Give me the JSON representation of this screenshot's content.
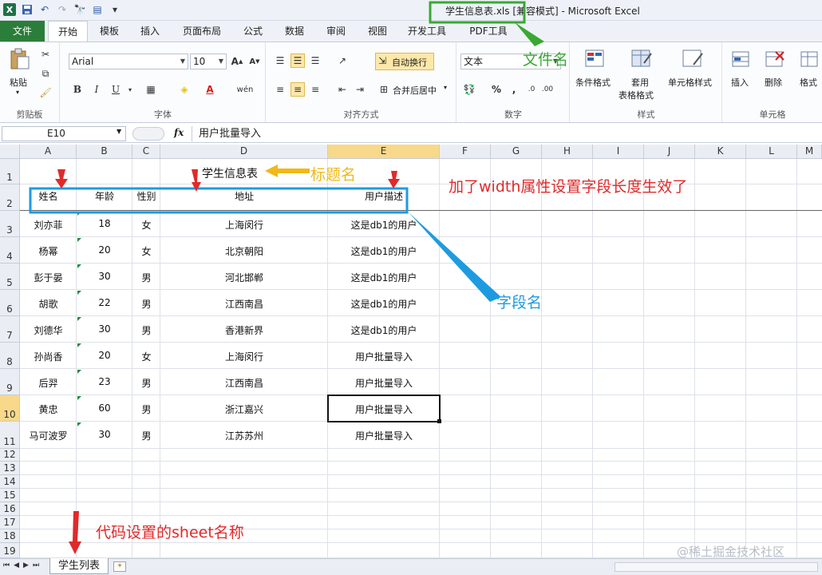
{
  "window": {
    "title": "学生信息表.xls  [兼容模式]  -  Microsoft Excel"
  },
  "tabs": [
    "文件",
    "开始",
    "模板",
    "插入",
    "页面布局",
    "公式",
    "数据",
    "审阅",
    "视图",
    "开发工具",
    "PDF工具"
  ],
  "ribbon": {
    "clipboard": {
      "paste": "粘贴",
      "label": "剪贴板"
    },
    "font": {
      "name": "Arial",
      "size": "10",
      "label": "字体",
      "bold": "B",
      "italic": "I",
      "underline": "U"
    },
    "alignment": {
      "wrap": "自动换行",
      "merge": "合并后居中",
      "label": "对齐方式"
    },
    "number": {
      "format": "文本",
      "label": "数字",
      "percent": "%",
      "comma": ","
    },
    "styles": {
      "conditional": "条件格式",
      "table_line1": "套用",
      "table_line2": "表格格式",
      "cell_style": "单元格样式",
      "label": "样式"
    },
    "cells": {
      "insert": "插入",
      "delete": "删除",
      "format": "格式",
      "label": "单元格"
    }
  },
  "formula_bar": {
    "name_box": "E10",
    "fx": "fx",
    "content": "用户批量导入"
  },
  "columns": [
    "A",
    "B",
    "C",
    "D",
    "E",
    "F",
    "G",
    "H",
    "I",
    "J",
    "K",
    "L",
    "M"
  ],
  "rows": [
    "1",
    "2",
    "3",
    "4",
    "5",
    "6",
    "7",
    "8",
    "9",
    "10",
    "11",
    "12",
    "13",
    "14",
    "15",
    "16",
    "17",
    "18",
    "19"
  ],
  "sheet": {
    "title": "学生信息表",
    "headers": [
      "姓名",
      "年龄",
      "性别",
      "地址",
      "用户描述"
    ],
    "data": [
      [
        "刘亦菲",
        "18",
        "女",
        "上海闵行",
        "这是db1的用户"
      ],
      [
        "杨幂",
        "20",
        "女",
        "北京朝阳",
        "这是db1的用户"
      ],
      [
        "彭于晏",
        "30",
        "男",
        "河北邯郸",
        "这是db1的用户"
      ],
      [
        "胡歌",
        "22",
        "男",
        "江西南昌",
        "这是db1的用户"
      ],
      [
        "刘德华",
        "30",
        "男",
        "香港新界",
        "这是db1的用户"
      ],
      [
        "孙尚香",
        "20",
        "女",
        "上海闵行",
        "用户批量导入"
      ],
      [
        "后羿",
        "23",
        "男",
        "江西南昌",
        "用户批量导入"
      ],
      [
        "黄忠",
        "60",
        "男",
        "浙江嘉兴",
        "用户批量导入"
      ],
      [
        "马可波罗",
        "30",
        "男",
        "江苏苏州",
        "用户批量导入"
      ]
    ]
  },
  "sheet_tab": "学生列表",
  "annotations": {
    "file_name": "文件名",
    "title_name": "标题名",
    "width_note": "加了width属性设置字段长度生效了",
    "field_name": "字段名",
    "sheet_name": "代码设置的sheet名称",
    "watermark": "@稀土掘金技术社区"
  },
  "colors": {
    "file_tab": "#2b7d3a",
    "selection": "#f8d88a",
    "annot_green": "#3aa832",
    "annot_red": "#e02a2a",
    "annot_blue": "#1e9be0",
    "annot_yellow": "#f0b818"
  }
}
